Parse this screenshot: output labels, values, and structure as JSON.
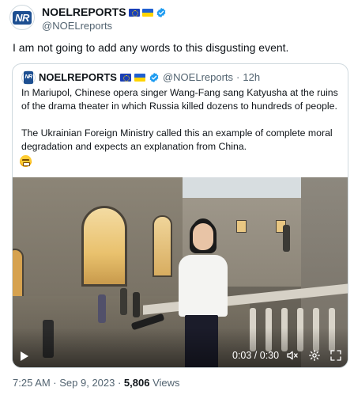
{
  "author": {
    "name": "NOELREPORTS",
    "handle": "@NOELreports",
    "logo_text": "NR"
  },
  "tweet": {
    "text": "I am not going to add any words to this disgusting event."
  },
  "quote": {
    "name": "NOELREPORTS",
    "handle": "@NOELreports",
    "separator": "·",
    "time": "12h",
    "paragraph1": "In Mariupol, Chinese opera singer Wang-Fang sang Katyusha at the ruins of the drama theater in which Russia killed dozens to hundreds of people.",
    "paragraph2": "The Ukrainian Foreign Ministry called this an example of complete moral degradation and expects an explanation from China.",
    "emoji": "angry-face"
  },
  "video": {
    "time_display": "0:03 / 0:30",
    "current_time": "0:03",
    "duration": "0:30"
  },
  "footer": {
    "timestamp": "7:25 AM · Sep 9, 2023 · ",
    "views_count": "5,806",
    "views_label": " Views"
  },
  "colors": {
    "text": "#0f1419",
    "secondary": "#536471",
    "verified": "#1d9bf0",
    "border": "#cfd9de"
  },
  "icons": [
    "eu-flag-icon",
    "ukraine-flag-icon",
    "verified-badge-icon",
    "play-icon",
    "volume-icon",
    "settings-icon",
    "fullscreen-icon"
  ]
}
